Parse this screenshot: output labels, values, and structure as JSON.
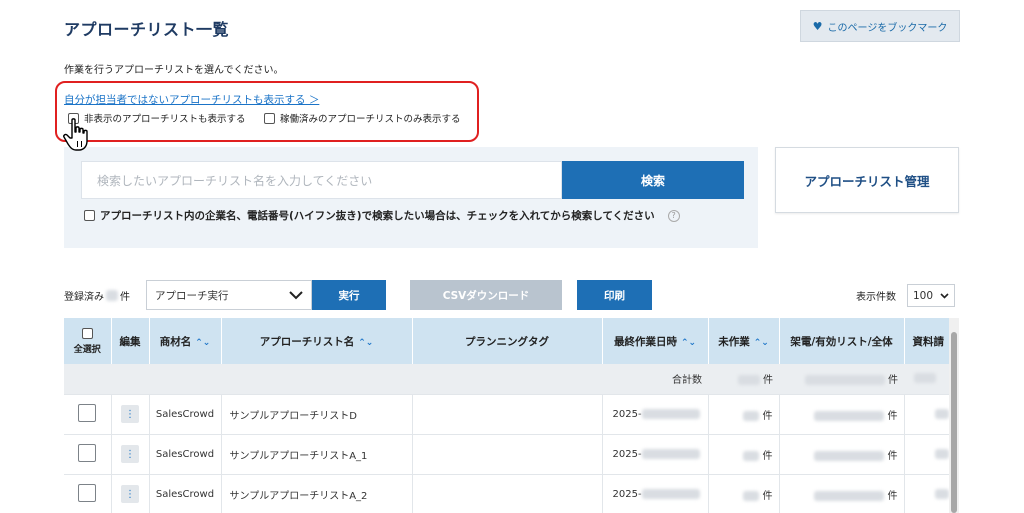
{
  "header": {
    "title": "アプローチリスト一覧",
    "bookmark_label": "このページをブックマーク"
  },
  "instruction": "作業を行うアプローチリストを選んでください。",
  "filters": {
    "show_others_link": "自分が担当者ではないアプローチリストも表示する ＞",
    "show_hidden_label": "非表示のアプローチリストも表示する",
    "show_active_only_label": "稼働済みのアプローチリストのみ表示する"
  },
  "search": {
    "placeholder": "検索したいアプローチリスト名を入力してください",
    "button_label": "検索",
    "note": "アプローチリスト内の企業名、電話番号(ハイフン抜き)で検索したい場合は、チェックを入れてから検索してください",
    "help_icon": "?"
  },
  "manage_button": "アプローチリスト管理",
  "toolbar": {
    "registered_prefix": "登録済み",
    "registered_suffix": "件",
    "action_selected": "アプローチ実行",
    "run_label": "実行",
    "csv_label": "CSVダウンロード",
    "print_label": "印刷",
    "per_page_label": "表示件数",
    "per_page_value": "100"
  },
  "table": {
    "headers": {
      "select_all": "全選択",
      "edit": "編集",
      "product": "商材名",
      "list_name": "アプローチリスト名",
      "planning_tag": "プランニングタグ",
      "last_work": "最終作業日時",
      "unworked": "未作業",
      "calls": "架電/有効リスト/全体",
      "docs": "資料請"
    },
    "total_label": "合計数",
    "count_unit": "件",
    "rows": [
      {
        "product": "SalesCrowd",
        "list_name": "サンプルアプローチリストD",
        "date_prefix": "2025-",
        "unit": "件"
      },
      {
        "product": "SalesCrowd",
        "list_name": "サンプルアプローチリストA_1",
        "date_prefix": "2025-",
        "unit": "件"
      },
      {
        "product": "SalesCrowd",
        "list_name": "サンプルアプローチリストA_2",
        "date_prefix": "2025-",
        "unit": "件"
      }
    ]
  },
  "colors": {
    "primary": "#1e6fb5",
    "title": "#1f3b63",
    "highlight": "#e02020",
    "header_bg": "#cfe3f1"
  }
}
